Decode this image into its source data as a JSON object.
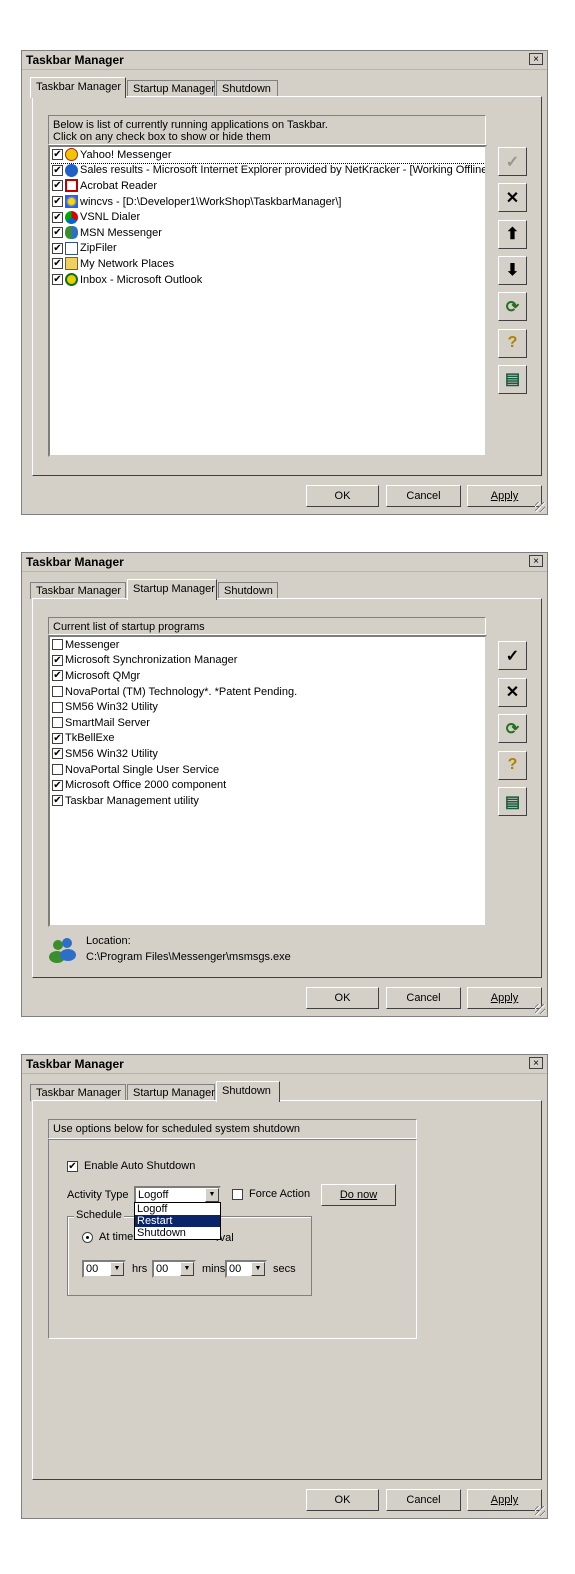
{
  "colors": {
    "face": "#d4d0c8",
    "highlight": "#0a246a",
    "list_bg": "#ffffff"
  },
  "common": {
    "title": "Taskbar Manager",
    "close": "×",
    "tabs": [
      "Taskbar Manager",
      "Startup Manager",
      "Shutdown"
    ],
    "ok": "OK",
    "cancel": "Cancel",
    "apply": "Apply"
  },
  "panel1": {
    "header": [
      "Below is list of currently running applications on Taskbar.",
      "Click on any check box to show or hide them"
    ],
    "items": [
      {
        "label": "Yahoo! Messenger",
        "checked": true,
        "icon": "yahoo-messenger-icon"
      },
      {
        "label": "Sales results - Microsoft Internet Explorer provided by NetKracker - [Working Offline]",
        "checked": true,
        "icon": "internet-explorer-icon"
      },
      {
        "label": "Acrobat Reader",
        "checked": true,
        "icon": "acrobat-icon"
      },
      {
        "label": "wincvs - [D:\\Developer1\\WorkShop\\TaskbarManager\\]",
        "checked": true,
        "icon": "wincvs-icon"
      },
      {
        "label": "VSNL Dialer",
        "checked": true,
        "icon": "dialer-icon"
      },
      {
        "label": "MSN Messenger",
        "checked": true,
        "icon": "msn-messenger-icon"
      },
      {
        "label": "ZipFiler",
        "checked": true,
        "icon": "zipfiler-icon"
      },
      {
        "label": "My Network Places",
        "checked": true,
        "icon": "network-places-icon"
      },
      {
        "label": "Inbox - Microsoft Outlook",
        "checked": true,
        "icon": "outlook-icon"
      }
    ],
    "sidebar": [
      {
        "icon": "checkmark-icon",
        "glyph": "✓",
        "disabled": true
      },
      {
        "icon": "close-icon",
        "glyph": "✕",
        "disabled": false
      },
      {
        "icon": "arrow-up-icon",
        "glyph": "⬆",
        "disabled": false
      },
      {
        "icon": "arrow-down-icon",
        "glyph": "⬇",
        "disabled": false
      },
      {
        "icon": "refresh-icon",
        "glyph": "⟳",
        "disabled": false
      },
      {
        "icon": "help-icon",
        "glyph": "?",
        "disabled": false
      },
      {
        "icon": "grid-icon",
        "glyph": "▤",
        "disabled": false
      }
    ]
  },
  "panel2": {
    "header": "Current list of startup programs",
    "items": [
      {
        "label": "Messenger",
        "checked": false
      },
      {
        "label": "Microsoft Synchronization Manager",
        "checked": true
      },
      {
        "label": "Microsoft QMgr",
        "checked": true
      },
      {
        "label": "NovaPortal (TM) Technology*. *Patent Pending.",
        "checked": false
      },
      {
        "label": "SM56 Win32 Utility",
        "checked": false
      },
      {
        "label": "SmartMail Server",
        "checked": false
      },
      {
        "label": "TkBellExe",
        "checked": true
      },
      {
        "label": "SM56 Win32 Utility",
        "checked": true
      },
      {
        "label": "NovaPortal Single User Service",
        "checked": false
      },
      {
        "label": "Microsoft Office 2000 component",
        "checked": true
      },
      {
        "label": "Taskbar Management utility",
        "checked": true
      }
    ],
    "sidebar": [
      {
        "icon": "checkmark-icon",
        "glyph": "✓"
      },
      {
        "icon": "close-icon",
        "glyph": "✕"
      },
      {
        "icon": "refresh-icon",
        "glyph": "⟳"
      },
      {
        "icon": "help-icon",
        "glyph": "?"
      },
      {
        "icon": "grid-icon",
        "glyph": "▤"
      }
    ],
    "location_label": "Location:",
    "location_path": "C:\\Program Files\\Messenger\\msmsgs.exe"
  },
  "panel3": {
    "header": "Use options below for scheduled system shutdown",
    "enable_label": "Enable Auto Shutdown",
    "enable_checked": true,
    "activity_label": "Activity Type",
    "activity_value": "Logoff",
    "activity_options": [
      "Logoff",
      "Restart",
      "Shutdown"
    ],
    "activity_highlighted": "Restart",
    "force_label": "Force Action",
    "force_checked": false,
    "do_now": "Do now",
    "schedule_label": "Schedule",
    "at_time_label": "At time",
    "interval_label_tail": "rval",
    "hrs_value": "00",
    "hrs_label": "hrs",
    "mins_value": "00",
    "mins_label": "mins",
    "secs_value": "00",
    "secs_label": "secs"
  }
}
